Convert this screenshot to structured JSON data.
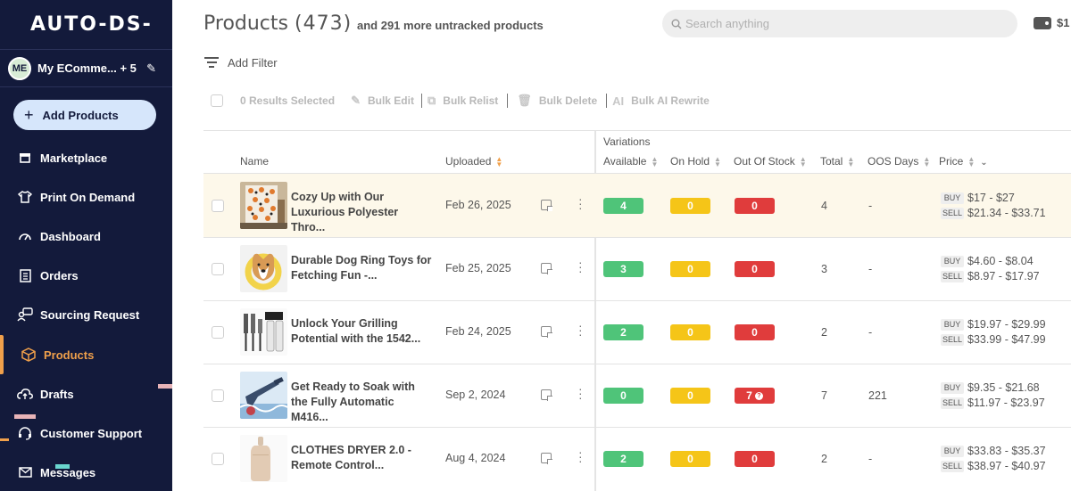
{
  "sidebar": {
    "logo": "AUTO-DS-",
    "store_initials": "ME",
    "store_name": "My EComme... + 5",
    "add_products": "Add Products",
    "items": [
      {
        "label": "Marketplace",
        "icon": "store-icon"
      },
      {
        "label": "Print On Demand",
        "icon": "shirt-icon"
      },
      {
        "label": "Dashboard",
        "icon": "gauge-icon"
      },
      {
        "label": "Orders",
        "icon": "clipboard-icon"
      },
      {
        "label": "Sourcing Request",
        "icon": "chat-user-icon"
      },
      {
        "label": "Products",
        "icon": "box-icon",
        "active": true
      },
      {
        "label": "Drafts",
        "icon": "cloud-upload-icon"
      },
      {
        "label": "Customer Support",
        "icon": "headset-icon"
      },
      {
        "label": "Messages",
        "icon": "mail-icon"
      }
    ],
    "active_color": "#f0a04b"
  },
  "header": {
    "title": "Products",
    "count": "(473)",
    "subtitle": "and 291 more untracked products",
    "search_placeholder": "Search anything",
    "balance": "$1"
  },
  "toolbar": {
    "add_filter": "Add Filter",
    "results_selected": "0 Results Selected",
    "bulk_edit": "Bulk Edit",
    "bulk_relist": "Bulk Relist",
    "bulk_delete": "Bulk Delete",
    "bulk_ai_rewrite": "Bulk AI Rewrite"
  },
  "table": {
    "group_header": "Variations",
    "columns": {
      "name": "Name",
      "uploaded": "Uploaded",
      "available": "Available",
      "on_hold": "On Hold",
      "out_of_stock": "Out Of Stock",
      "total": "Total",
      "oos_days": "OOS Days",
      "price": "Price"
    },
    "buy_tag": "BUY",
    "sell_tag": "SELL",
    "rows": [
      {
        "name": "Cozy Up with Our Luxurious Polyester Thro...",
        "uploaded": "Feb 26, 2025",
        "available": "4",
        "on_hold": "0",
        "out_of_stock": "0",
        "total": "4",
        "oos_days": "-",
        "buy": "$17 - $27",
        "sell": "$21.34 - $33.71"
      },
      {
        "name": "Durable Dog Ring Toys for Fetching Fun -...",
        "uploaded": "Feb 25, 2025",
        "available": "3",
        "on_hold": "0",
        "out_of_stock": "0",
        "total": "3",
        "oos_days": "-",
        "buy": "$4.60 - $8.04",
        "sell": "$8.97 - $17.97"
      },
      {
        "name": "Unlock Your Grilling Potential with the 1542...",
        "uploaded": "Feb 24, 2025",
        "available": "2",
        "on_hold": "0",
        "out_of_stock": "0",
        "total": "2",
        "oos_days": "-",
        "buy": "$19.97 - $29.99",
        "sell": "$33.99 - $47.99"
      },
      {
        "name": "Get Ready to Soak with the Fully Automatic M416...",
        "uploaded": "Sep 2, 2024",
        "available": "0",
        "on_hold": "0",
        "out_of_stock": "7",
        "total": "7",
        "oos_days": "221",
        "buy": "$9.35 - $21.68",
        "sell": "$11.97 - $23.97"
      },
      {
        "name": "CLOTHES DRYER 2.0 - Remote Control...",
        "uploaded": "Aug 4, 2024",
        "available": "2",
        "on_hold": "0",
        "out_of_stock": "0",
        "total": "2",
        "oos_days": "-",
        "buy": "$33.83 - $35.37",
        "sell": "$38.97 - $40.97"
      }
    ]
  },
  "colors": {
    "sidebar_bg": "#131a3b",
    "available": "#4fc479",
    "on_hold": "#f5c518",
    "out_of_stock": "#e03c3c",
    "highlight_row": "#fdf8ea"
  }
}
